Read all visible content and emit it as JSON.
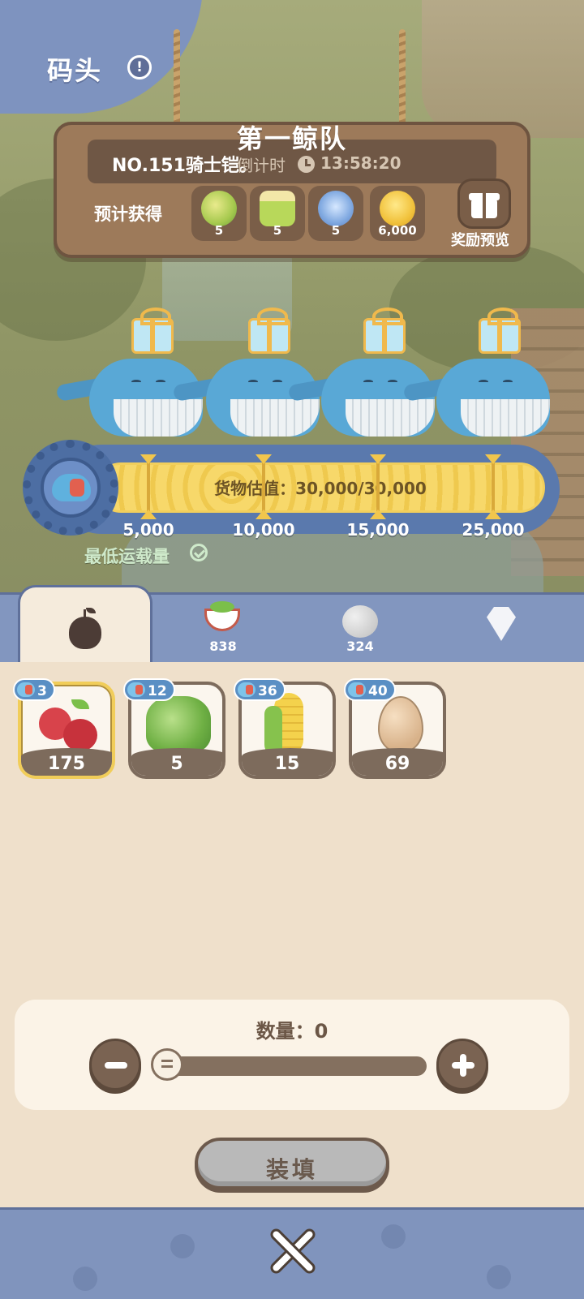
{
  "header": {
    "title": "码头"
  },
  "fleet": {
    "name": "第一鲸队",
    "ship_name": "NO.151骑士铠。",
    "countdown_label": "倒计时",
    "countdown_time": "13:58:20"
  },
  "rewards": {
    "label": "预计获得",
    "items": [
      {
        "icon": "leaf-seed-icon",
        "count": "5"
      },
      {
        "icon": "potion-bottle-icon",
        "count": "5"
      },
      {
        "icon": "blue-flower-icon",
        "count": "5"
      },
      {
        "icon": "gold-coin-icon",
        "count": "6,000"
      }
    ],
    "preview_label": "奖励预览"
  },
  "cargo": {
    "value_text": "货物估值：30,000/30,000",
    "current": 30000,
    "max": 30000,
    "milestones": [
      "5,000",
      "10,000",
      "15,000",
      "25,000"
    ],
    "min_load_label": "最低运载量"
  },
  "tabs": [
    {
      "icon": "apple-icon",
      "count": ""
    },
    {
      "icon": "salad-bowl-icon",
      "count": "838"
    },
    {
      "icon": "stone-icon",
      "count": "324"
    },
    {
      "icon": "crystal-icon",
      "count": ""
    }
  ],
  "items": [
    {
      "icon": "apple-icon",
      "badge": "3",
      "qty": "175"
    },
    {
      "icon": "lettuce-icon",
      "badge": "12",
      "qty": "5"
    },
    {
      "icon": "corn-icon",
      "badge": "36",
      "qty": "15"
    },
    {
      "icon": "egg-icon",
      "badge": "40",
      "qty": "69"
    }
  ],
  "quantity": {
    "label": "数量：0",
    "value": 0
  },
  "load_button": "装填",
  "colors": {
    "accent_yellow": "#f1cd59",
    "blue_bar": "#8296bf",
    "wood": "#9d7a5a",
    "panel_bg": "#efe0cb"
  }
}
